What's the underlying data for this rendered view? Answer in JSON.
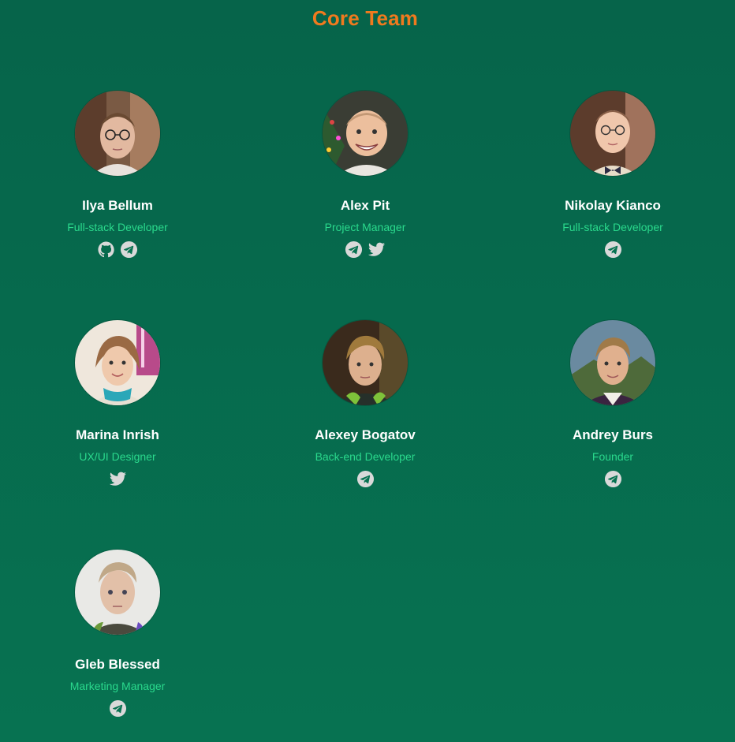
{
  "page": {
    "title": "Core Team"
  },
  "colors": {
    "title": "#f07a1e",
    "role": "#2ad98c",
    "name": "#ffffff",
    "icon": "#d9d9d9",
    "background_top": "#06644a",
    "background_bottom": "#077251"
  },
  "members": [
    {
      "name": "Ilya Bellum",
      "role": "Full-stack Developer",
      "socials": [
        "github-icon",
        "telegram-icon"
      ]
    },
    {
      "name": "Alex Pit",
      "role": "Project Manager",
      "socials": [
        "telegram-icon",
        "twitter-icon"
      ]
    },
    {
      "name": "Nikolay Kianco",
      "role": "Full-stack Developer",
      "socials": [
        "telegram-icon"
      ]
    },
    {
      "name": "Marina Inrish",
      "role": "UX/UI Designer",
      "socials": [
        "twitter-icon"
      ]
    },
    {
      "name": "Alexey Bogatov",
      "role": "Back-end Developer",
      "socials": [
        "telegram-icon"
      ]
    },
    {
      "name": "Andrey Burs",
      "role": "Founder",
      "socials": [
        "telegram-icon"
      ]
    },
    {
      "name": "Gleb Blessed",
      "role": "Marketing Manager",
      "socials": [
        "telegram-icon"
      ]
    }
  ]
}
